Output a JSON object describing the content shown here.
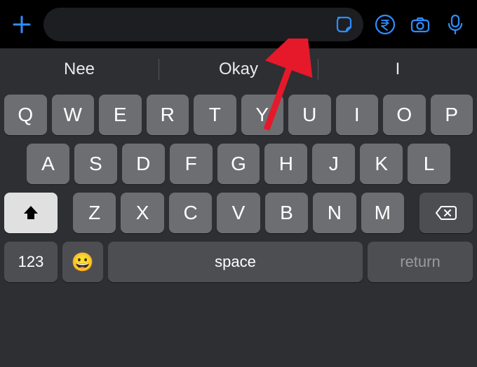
{
  "topbar": {
    "plus_icon": "plus",
    "sticker_icon": "sticker",
    "rupee_icon": "rupee",
    "camera_icon": "camera",
    "mic_icon": "mic",
    "input_placeholder": ""
  },
  "suggestions": [
    "Nee",
    "Okay",
    "I"
  ],
  "keyboard": {
    "row1": [
      "Q",
      "W",
      "E",
      "R",
      "T",
      "Y",
      "U",
      "I",
      "O",
      "P"
    ],
    "row2": [
      "A",
      "S",
      "D",
      "F",
      "G",
      "H",
      "J",
      "K",
      "L"
    ],
    "row3": [
      "Z",
      "X",
      "C",
      "V",
      "B",
      "N",
      "M"
    ],
    "numbers_label": "123",
    "space_label": "space",
    "return_label": "return",
    "emoji": "😀"
  },
  "annotation": {
    "arrow_target": "sticker-button"
  }
}
